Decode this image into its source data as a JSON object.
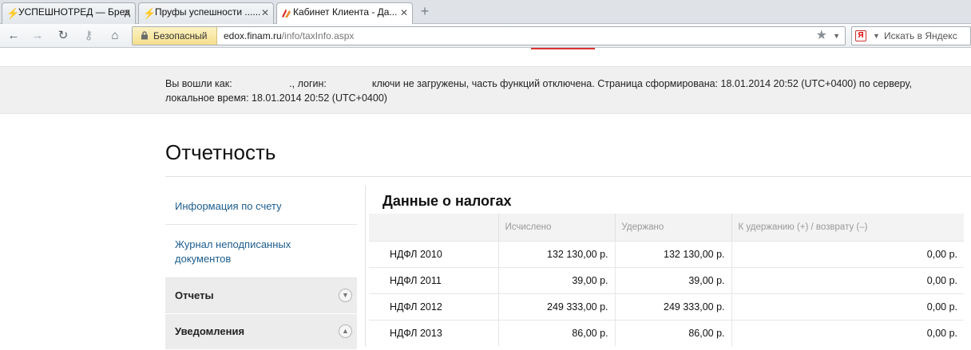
{
  "browser": {
    "tabs": [
      {
        "title": "УСПЕШНОТРЕД — Бред"
      },
      {
        "title": "Пруфы успешности ......"
      },
      {
        "title": "Кабинет Клиента - Да..."
      }
    ],
    "security_label": "Безопасный",
    "url_domain": "edox.finam.ru",
    "url_path": "/info/taxInfo.aspx",
    "search_placeholder": "Искать в Яндекс"
  },
  "info": {
    "part1": "Вы вошли как:",
    "part2": "., логин:",
    "part3": "ключи не загружены, часть функций отключена. Страница сформирована: 18.01.2014 20:52 (UTC+0400) по серверу, локальное время: 18.01.2014 20:52 (UTC+0400)"
  },
  "page": {
    "title": "Отчетность"
  },
  "sidebar": {
    "links": [
      "Информация по счету",
      "Журнал неподписанных документов"
    ],
    "sections": [
      "Отчеты",
      "Уведомления"
    ]
  },
  "tax_table": {
    "title": "Данные о налогах",
    "columns": [
      "",
      "Исчислено",
      "Удержано",
      "К удержанию (+) / возврату (–)"
    ],
    "rows": [
      {
        "name": "НДФЛ 2010",
        "calculated": "132 130,00 р.",
        "withheld": "132 130,00 р.",
        "balance": "0,00 р."
      },
      {
        "name": "НДФЛ 2011",
        "calculated": "39,00 р.",
        "withheld": "39,00 р.",
        "balance": "0,00 р."
      },
      {
        "name": "НДФЛ 2012",
        "calculated": "249 333,00 р.",
        "withheld": "249 333,00 р.",
        "balance": "0,00 р."
      },
      {
        "name": "НДФЛ 2013",
        "calculated": "86,00 р.",
        "withheld": "86,00 р.",
        "balance": "0,00 р."
      }
    ]
  }
}
